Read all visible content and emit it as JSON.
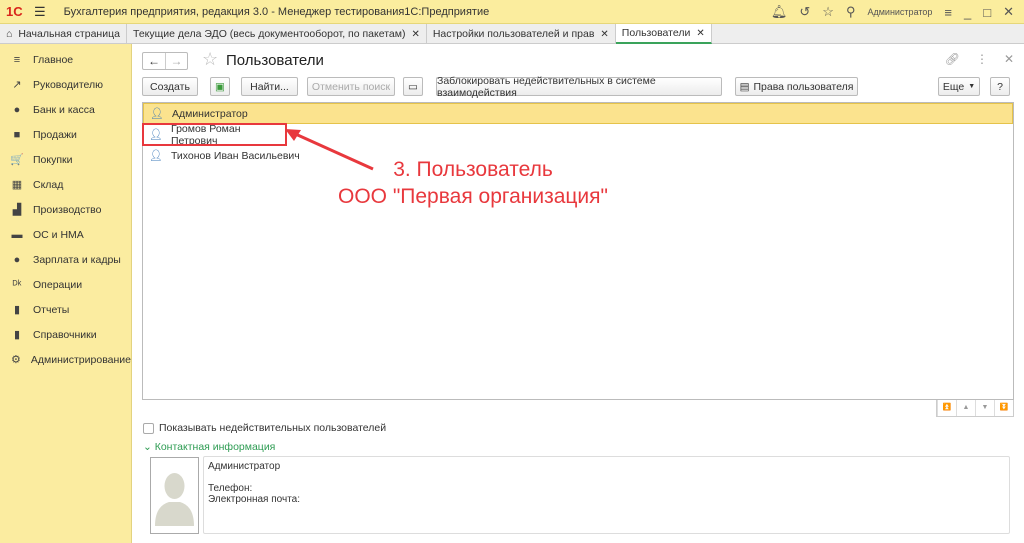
{
  "titlebar": {
    "logo": "1С",
    "title": "Бухгалтерия предприятия, редакция 3.0  - Менеджер тестирования1С:Предприятие",
    "user": "Администратор"
  },
  "tabs": [
    {
      "label": "Начальная страница"
    },
    {
      "label": "Текущие дела ЭДО (весь документооборот, по пакетам)"
    },
    {
      "label": "Настройки пользователей и прав"
    },
    {
      "label": "Пользователи"
    }
  ],
  "sidebar": {
    "items": [
      {
        "label": "Главное",
        "icon": "≡"
      },
      {
        "label": "Руководителю",
        "icon": "↗"
      },
      {
        "label": "Банк и касса",
        "icon": "●"
      },
      {
        "label": "Продажи",
        "icon": "■"
      },
      {
        "label": "Покупки",
        "icon": "🛒"
      },
      {
        "label": "Склад",
        "icon": "▦"
      },
      {
        "label": "Производство",
        "icon": "▟"
      },
      {
        "label": "ОС и НМА",
        "icon": "▬"
      },
      {
        "label": "Зарплата и кадры",
        "icon": "●"
      },
      {
        "label": "Операции",
        "icon": "ᴰᵏ"
      },
      {
        "label": "Отчеты",
        "icon": "▮"
      },
      {
        "label": "Справочники",
        "icon": "▮"
      },
      {
        "label": "Администрирование",
        "icon": "⚙"
      }
    ]
  },
  "page": {
    "title": "Пользователи"
  },
  "toolbar": {
    "create": "Создать",
    "find": "Найти...",
    "cancel_search": "Отменить поиск",
    "block": "Заблокировать недействительных в системе взаимодействия",
    "rights": "Права пользователя",
    "more": "Еще",
    "help": "?"
  },
  "users": [
    {
      "name": "Администратор"
    },
    {
      "name": "Громов Роман Петрович"
    },
    {
      "name": "Тихонов Иван Васильевич"
    }
  ],
  "annotation": {
    "line1": "3. Пользователь",
    "line2": "ООО \"Первая организация\""
  },
  "show_invalid": "Показывать недействительных пользователей",
  "contact": {
    "header": "Контактная информация",
    "name": "Администратор",
    "phone": "Телефон:",
    "email": "Электронная почта:"
  }
}
